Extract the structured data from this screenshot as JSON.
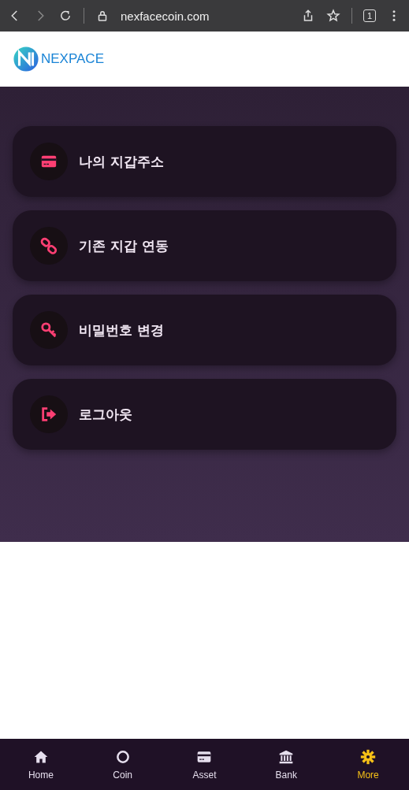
{
  "browser": {
    "url": "nexfacecoin.com",
    "tab_count": "1"
  },
  "header": {
    "brand": "NEXPACE"
  },
  "menu": [
    {
      "kind": "card",
      "label": "나의 지갑주소"
    },
    {
      "kind": "link",
      "label": "기존 지갑 연동"
    },
    {
      "kind": "key",
      "label": "비밀번호 변경"
    },
    {
      "kind": "logout",
      "label": "로그아웃"
    }
  ],
  "nav": [
    {
      "kind": "home",
      "label": "Home",
      "selected": false
    },
    {
      "kind": "circle",
      "label": "Coin",
      "selected": false
    },
    {
      "kind": "card",
      "label": "Asset",
      "selected": false
    },
    {
      "kind": "bank",
      "label": "Bank",
      "selected": false
    },
    {
      "kind": "gear",
      "label": "More",
      "selected": true
    }
  ]
}
